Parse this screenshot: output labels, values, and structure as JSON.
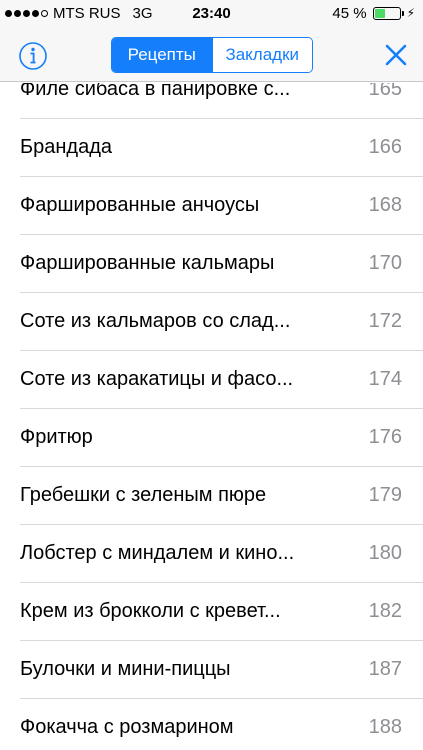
{
  "status_bar": {
    "carrier": "MTS RUS",
    "network": "3G",
    "time": "23:40",
    "battery_percent_label": "45 %",
    "battery_level": 0.45,
    "signal_bars_filled": 4,
    "signal_bars_total": 5
  },
  "nav": {
    "segments": [
      "Рецепты",
      "Закладки"
    ],
    "selected_segment": "Рецепты",
    "accent_color": "#157efb"
  },
  "list": {
    "items": [
      {
        "title": "Филе сибаса в панировке с...",
        "page": "165"
      },
      {
        "title": "Брандада",
        "page": "166"
      },
      {
        "title": "Фаршированные анчоусы",
        "page": "168"
      },
      {
        "title": "Фаршированные кальмары",
        "page": "170"
      },
      {
        "title": "Соте из кальмаров со слад...",
        "page": "172"
      },
      {
        "title": "Соте из каракатицы и фасо...",
        "page": "174"
      },
      {
        "title": "Фритюр",
        "page": "176"
      },
      {
        "title": "Гребешки с зеленым пюре",
        "page": "179"
      },
      {
        "title": "Лобстер с миндалем и кино...",
        "page": "180"
      },
      {
        "title": "Крем из брокколи с кревет...",
        "page": "182"
      },
      {
        "title": "Булочки и мини-пиццы",
        "page": "187"
      },
      {
        "title": "Фокачча с розмарином",
        "page": "188"
      }
    ]
  }
}
